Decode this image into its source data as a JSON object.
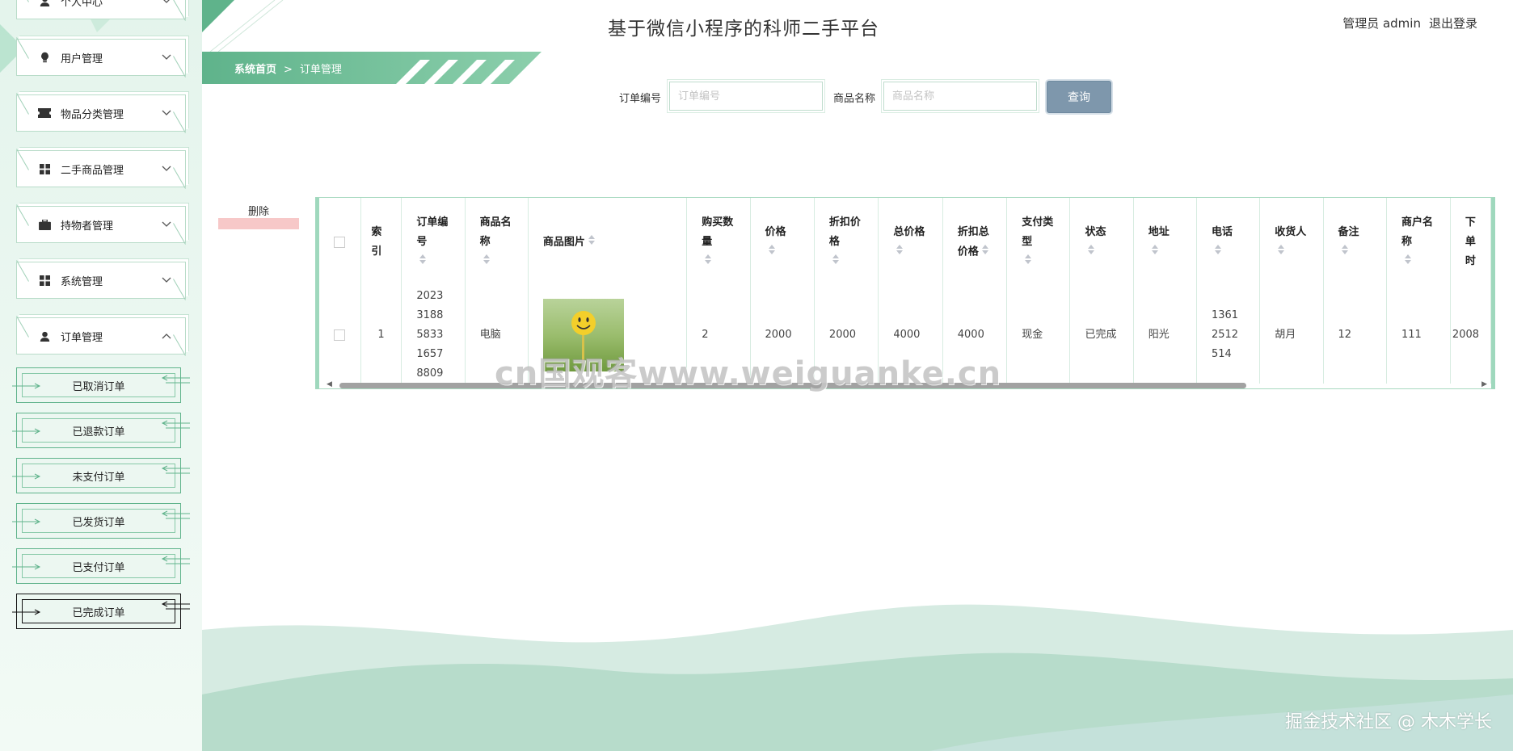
{
  "header": {
    "title": "基于微信小程序的科师二手平台",
    "user_role": "管理员 admin",
    "logout": "退出登录"
  },
  "breadcrumb": {
    "home": "系统首页",
    "separator": ">",
    "current": "订单管理"
  },
  "sidebar": {
    "top_partial": "个人中心",
    "items": [
      {
        "label": "用户管理",
        "icon": "lightbulb-icon"
      },
      {
        "label": "物品分类管理",
        "icon": "ticket-icon"
      },
      {
        "label": "二手商品管理",
        "icon": "grid-icon"
      },
      {
        "label": "持物者管理",
        "icon": "briefcase-icon"
      },
      {
        "label": "系统管理",
        "icon": "grid-icon"
      },
      {
        "label": "订单管理",
        "icon": "user-icon",
        "expanded": true
      }
    ],
    "sub_items": [
      {
        "label": "已取消订单"
      },
      {
        "label": "已退款订单"
      },
      {
        "label": "未支付订单"
      },
      {
        "label": "已发货订单"
      },
      {
        "label": "已支付订单"
      },
      {
        "label": "已完成订单",
        "active": true
      }
    ]
  },
  "search": {
    "order_no_label": "订单编号",
    "order_no_placeholder": "订单编号",
    "product_label": "商品名称",
    "product_placeholder": "商品名称",
    "button": "查询"
  },
  "actions": {
    "delete": "删除"
  },
  "table": {
    "headers": {
      "index": "索引",
      "order_no": "订单编号",
      "product_name": "商品名称",
      "product_image": "商品图片",
      "quantity": "购买数量",
      "price": "价格",
      "discount_price": "折扣价格",
      "total_price": "总价格",
      "discount_total": "折扣总价格",
      "pay_type": "支付类型",
      "status": "状态",
      "address": "地址",
      "phone": "电话",
      "receiver": "收货人",
      "note": "备注",
      "merchant_name": "商户名称",
      "next": "下单时"
    },
    "rows": [
      {
        "index": "1",
        "order_no": "20233188583316578809",
        "product_name": "电脑",
        "quantity": "2",
        "price": "2000",
        "discount_price": "2000",
        "total_price": "4000",
        "discount_total": "4000",
        "pay_type": "现金",
        "status": "已完成",
        "address": "阳光",
        "phone": "13612512514",
        "receiver": "胡月",
        "note": "12",
        "merchant_name": "111",
        "next": "2008"
      }
    ]
  },
  "watermark": "cn国观客www.weiguanke.cn",
  "footer_mark": "掘金技术社区 @ 木木学长",
  "colors": {
    "accent_green": "#5fb38b",
    "sidebar_bg": "#e4f4ec",
    "search_button": "#7e97ac",
    "delete_bar": "#f7c8c8"
  }
}
